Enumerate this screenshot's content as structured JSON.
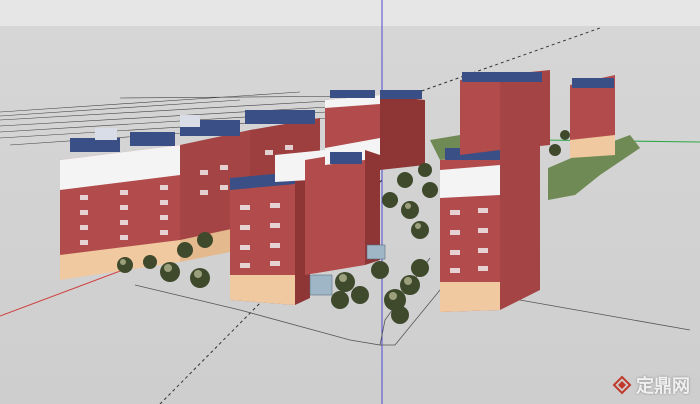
{
  "scene": {
    "description_free": true,
    "colors": {
      "ground": "#cfcfcf",
      "brick": "#b24b4b",
      "brick_dark": "#8e3535",
      "base": "#f0c9a0",
      "roof": "#3a4f86",
      "white": "#f4f4f4",
      "tree": "#3f4a2c",
      "lawn": "#6f8a55",
      "axis_red": "#d04040",
      "axis_green": "#2fa84a",
      "axis_blue": "#4a4ad0"
    }
  },
  "watermark": {
    "text": "定鼎网",
    "logo_icon": "dingding-logo-icon"
  }
}
